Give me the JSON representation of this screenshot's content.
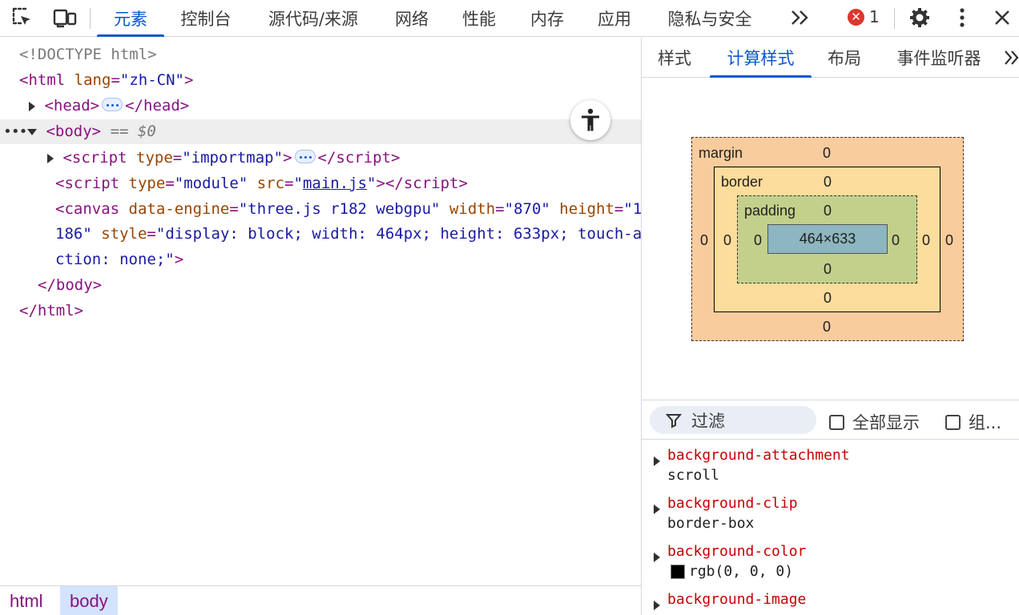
{
  "toolbar": {
    "tabs": [
      {
        "label": "元素",
        "active": true
      },
      {
        "label": "控制台",
        "active": false
      },
      {
        "label": "源代码/来源",
        "active": false
      },
      {
        "label": "网络",
        "active": false
      },
      {
        "label": "性能",
        "active": false
      },
      {
        "label": "内存",
        "active": false
      },
      {
        "label": "应用",
        "active": false
      },
      {
        "label": "隐私与安全",
        "active": false
      }
    ],
    "more_label": "»",
    "error_count": "1",
    "icons": [
      "inspect-element-icon",
      "device-toolbar-icon",
      "more-tabs-icon",
      "error-icon",
      "settings-gear-icon",
      "kebab-menu-icon",
      "close-icon"
    ]
  },
  "dom_tree": {
    "doctype": "<!DOCTYPE html>",
    "html_open_tag": "html",
    "html_lang_attr": "lang",
    "html_lang_val": "\"zh-CN\"",
    "head_tag": "head",
    "body_tag": "body",
    "selected_marker": "== $0",
    "script1_tag": "script",
    "script1_type_attr": "type",
    "script1_type_val": "\"importmap\"",
    "script2_tag": "script",
    "script2_type_attr": "type",
    "script2_type_val": "\"module\"",
    "script2_src_attr": "src",
    "script2_src_val": "main.js",
    "canvas_tag": "canvas",
    "canvas_engine_attr": "data-engine",
    "canvas_engine_val": "\"three.js r182 webgpu\"",
    "canvas_width_attr": "width",
    "canvas_width_val": "\"870\"",
    "canvas_height_attr": "height",
    "canvas_height_val_line1": "\"1",
    "canvas_height_val_line2": "186\"",
    "canvas_style_attr": "style",
    "canvas_style_val_line2": "\"display: block; width: 464px; height: 633px; touch-a",
    "canvas_style_val_line3": "ction: none;\"",
    "body_close": "</body>",
    "html_close": "</html>"
  },
  "breadcrumbs": [
    {
      "label": "html",
      "selected": false
    },
    {
      "label": "body",
      "selected": true
    }
  ],
  "styles_panel": {
    "tabs": [
      {
        "label": "样式",
        "active": false
      },
      {
        "label": "计算样式",
        "active": true
      },
      {
        "label": "布局",
        "active": false
      },
      {
        "label": "事件监听器",
        "active": false
      }
    ],
    "box_model": {
      "margin_label": "margin",
      "border_label": "border",
      "padding_label": "padding",
      "content_size": "464×633",
      "margin": {
        "top": "0",
        "right": "0",
        "bottom": "0",
        "left": "0"
      },
      "border": {
        "top": "0",
        "right": "0",
        "bottom": "0",
        "left": "0"
      },
      "padding": {
        "top": "0",
        "right": "0",
        "bottom": "0",
        "left": "0"
      }
    },
    "filter": {
      "placeholder": "过滤",
      "show_all_label": "全部显示",
      "group_label": "组..."
    },
    "properties": [
      {
        "name": "background-attachment",
        "value": "scroll"
      },
      {
        "name": "background-clip",
        "value": "border-box"
      },
      {
        "name": "background-color",
        "value": "rgb(0, 0, 0)",
        "swatch": "#000000"
      },
      {
        "name": "background-image",
        "value": ""
      }
    ]
  },
  "colors": {
    "accent": "#0b57d0",
    "tag": "#881280",
    "attr_name": "#994500",
    "attr_value": "#1a1aa6",
    "error": "#dc362e",
    "prop_name": "#c80000",
    "margin_box": "#f9cc9d",
    "border_box": "#fddd9b",
    "padding_box": "#c3d08b",
    "content_box": "#8cb6c0"
  }
}
